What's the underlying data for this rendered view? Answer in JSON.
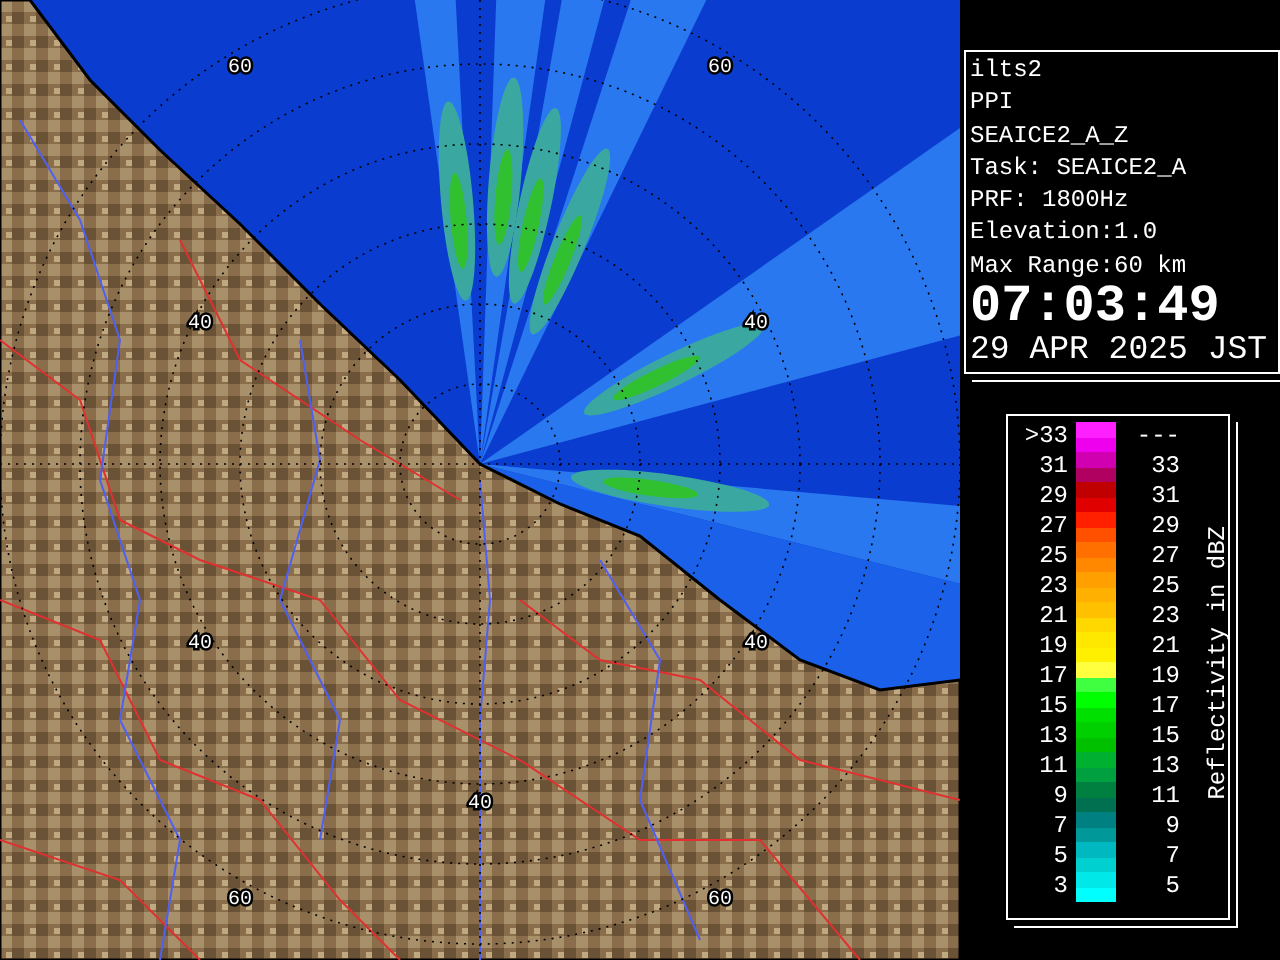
{
  "radar_map": {
    "range_labels": [
      "60",
      "60",
      "40",
      "40",
      "40",
      "40",
      "40",
      "60",
      "60"
    ]
  },
  "info": {
    "lines": [
      "ilts2",
      "PPI",
      "SEAICE2_A_Z",
      "Task: SEAICE2_A",
      "PRF: 1800Hz",
      "Elevation:1.0",
      "Max Range:60 km"
    ],
    "time": "07:03:49",
    "date": "29 APR 2025 JST"
  },
  "legend": {
    "title": "Reflectivity in dBZ",
    "rows": [
      {
        "low": ">33",
        "high": "---",
        "swatches": [
          {
            "color": "#ff20ff"
          },
          {
            "color": "#ee00ee"
          }
        ]
      },
      {
        "low": "31",
        "high": "33",
        "swatches": [
          {
            "color": "#d000b0"
          },
          {
            "color": "#b00060"
          }
        ]
      },
      {
        "low": "29",
        "high": "31",
        "swatches": [
          {
            "color": "#c00000"
          },
          {
            "color": "#e00000"
          }
        ]
      },
      {
        "low": "27",
        "high": "29",
        "swatches": [
          {
            "color": "#ff2000"
          },
          {
            "color": "#ff5000"
          }
        ]
      },
      {
        "low": "25",
        "high": "27",
        "swatches": [
          {
            "color": "#ff7000"
          },
          {
            "color": "#ff8800"
          }
        ]
      },
      {
        "low": "23",
        "high": "25",
        "swatches": [
          {
            "color": "#ffa000"
          },
          {
            "color": "#ffb000"
          }
        ]
      },
      {
        "low": "21",
        "high": "23",
        "swatches": [
          {
            "color": "#ffc000"
          },
          {
            "color": "#ffd800"
          }
        ]
      },
      {
        "low": "19",
        "high": "21",
        "swatches": [
          {
            "color": "#ffe800"
          },
          {
            "color": "#fff000"
          }
        ]
      },
      {
        "low": "17",
        "high": "19",
        "swatches": [
          {
            "color": "#ffff40"
          },
          {
            "color": "#40ff40"
          }
        ]
      },
      {
        "low": "15",
        "high": "17",
        "swatches": [
          {
            "color": "#00ff00"
          },
          {
            "color": "#00e000"
          }
        ]
      },
      {
        "low": "13",
        "high": "15",
        "swatches": [
          {
            "color": "#00d000"
          },
          {
            "color": "#00c000"
          }
        ]
      },
      {
        "low": "11",
        "high": "13",
        "swatches": [
          {
            "color": "#00b030"
          },
          {
            "color": "#00a040"
          }
        ]
      },
      {
        "low": "9",
        "high": "11",
        "swatches": [
          {
            "color": "#008040"
          },
          {
            "color": "#007050"
          }
        ]
      },
      {
        "low": "7",
        "high": "9",
        "swatches": [
          {
            "color": "#008080"
          },
          {
            "color": "#009898"
          }
        ]
      },
      {
        "low": "5",
        "high": "7",
        "swatches": [
          {
            "color": "#00b8c0"
          },
          {
            "color": "#00d0d0"
          }
        ]
      },
      {
        "low": "3",
        "high": "5",
        "swatches": [
          {
            "color": "#00e8e8"
          },
          {
            "color": "#00ffff"
          }
        ]
      }
    ]
  }
}
